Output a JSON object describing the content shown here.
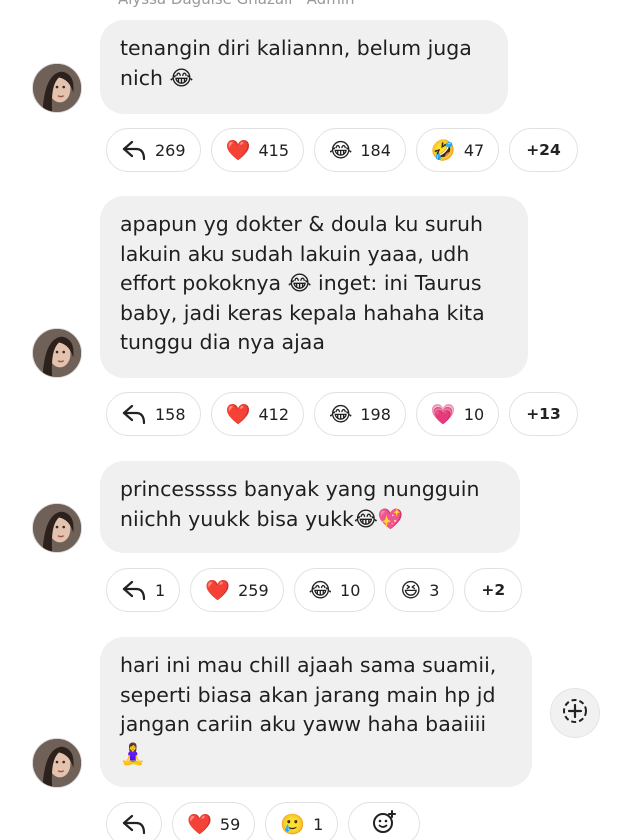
{
  "header": {
    "sender_name_cut": "Alyssa Daguise Ghazali · Admin"
  },
  "messages": [
    {
      "text": "tenangin diri kaliannn, belum juga\nnich 😂",
      "reactions": [
        {
          "icon": "reply-icon",
          "count": "269"
        },
        {
          "icon": "red-heart-icon",
          "emoji": "❤️",
          "count": "415"
        },
        {
          "icon": "tears-of-joy-icon",
          "emoji": "😂",
          "count": "184"
        },
        {
          "icon": "rofl-icon",
          "emoji": "🤣",
          "count": "47"
        },
        {
          "more": "+24"
        }
      ]
    },
    {
      "text": "apapun yg dokter & doula ku suruh\nlakuin aku sudah lakuin yaaa, udh\neffort pokoknya 😂 inget: ini Taurus\nbaby, jadi keras kepala hahaha kita\ntunggu dia nya ajaa",
      "reactions": [
        {
          "icon": "reply-icon",
          "count": "158"
        },
        {
          "icon": "red-heart-icon",
          "emoji": "❤️",
          "count": "412"
        },
        {
          "icon": "tears-of-joy-icon",
          "emoji": "😂",
          "count": "198"
        },
        {
          "icon": "growing-heart-icon",
          "emoji": "💗",
          "count": "10"
        },
        {
          "more": "+13"
        }
      ]
    },
    {
      "text": "princesssss banyak yang nungguin\nniichh yuukk bisa yukk😂💖",
      "reactions": [
        {
          "icon": "reply-icon",
          "count": "1"
        },
        {
          "icon": "red-heart-icon",
          "emoji": "❤️",
          "count": "259"
        },
        {
          "icon": "tears-of-joy-icon",
          "emoji": "😂",
          "count": "10"
        },
        {
          "icon": "grinning-squint-icon",
          "emoji": "😆",
          "count": "3"
        },
        {
          "more": "+2"
        }
      ]
    },
    {
      "text": "hari ini mau chill ajaah sama suamii,\nseperti biasa akan jarang main hp jd\njangan cariin aku yaww haha baaiiii\n🧘‍♀️",
      "reactions": [
        {
          "icon": "reply-icon",
          "count": ""
        },
        {
          "icon": "red-heart-icon",
          "emoji": "❤️",
          "count": "59"
        },
        {
          "icon": "face-holding-tears-icon",
          "emoji": "🥲",
          "count": "1"
        },
        {
          "icon": "add-reaction-icon",
          "emoji": ""
        }
      ]
    }
  ]
}
